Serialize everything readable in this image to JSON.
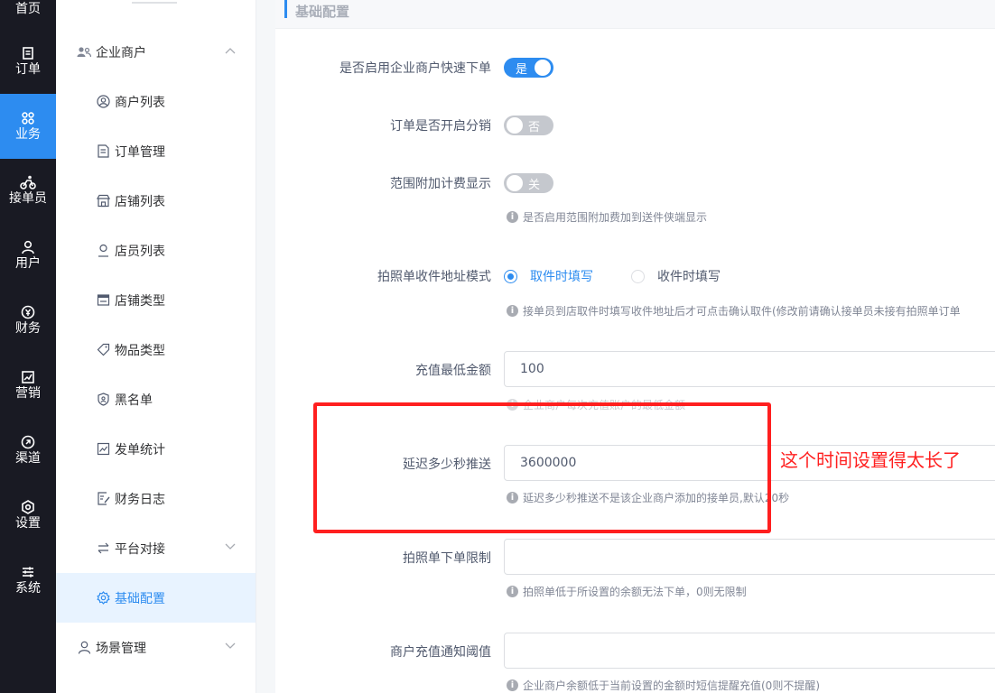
{
  "rail": {
    "items": [
      {
        "label": "首页",
        "icon": "home-icon"
      },
      {
        "label": "订单",
        "icon": "order-icon"
      },
      {
        "label": "业务",
        "icon": "business-icon"
      },
      {
        "label": "接单员",
        "icon": "courier-icon"
      },
      {
        "label": "用户",
        "icon": "user-icon"
      },
      {
        "label": "财务",
        "icon": "finance-icon"
      },
      {
        "label": "营销",
        "icon": "marketing-icon"
      },
      {
        "label": "渠道",
        "icon": "channel-icon"
      },
      {
        "label": "设置",
        "icon": "settings-icon"
      },
      {
        "label": "系统",
        "icon": "system-icon"
      }
    ],
    "active_index": 2
  },
  "submenu": {
    "group_label": "企业商户",
    "items": [
      {
        "label": "商户列表",
        "icon": "merchant-icon"
      },
      {
        "label": "订单管理",
        "icon": "doc-icon"
      },
      {
        "label": "店铺列表",
        "icon": "store-icon"
      },
      {
        "label": "店员列表",
        "icon": "staff-icon"
      },
      {
        "label": "店铺类型",
        "icon": "store-type-icon"
      },
      {
        "label": "物品类型",
        "icon": "tag-icon"
      },
      {
        "label": "黑名单",
        "icon": "shield-icon"
      },
      {
        "label": "发单统计",
        "icon": "chart-icon"
      },
      {
        "label": "财务日志",
        "icon": "log-icon"
      },
      {
        "label": "平台对接",
        "icon": "swap-icon"
      },
      {
        "label": "基础配置",
        "icon": "gear-icon"
      }
    ],
    "active_label": "基础配置",
    "scene_label": "场景管理"
  },
  "panel": {
    "title": "基础配置"
  },
  "form": {
    "quick_order": {
      "label": "是否启用企业商户快速下单",
      "value": "是",
      "enabled": true
    },
    "distribution": {
      "label": "订单是否开启分销",
      "value": "否",
      "enabled": false
    },
    "range_fee": {
      "label": "范围附加计费显示",
      "value": "关",
      "enabled": false,
      "help": "是否启用范围附加费加到送件侠端显示"
    },
    "photo_address": {
      "label": "拍照单收件地址模式",
      "options": [
        "取件时填写",
        "收件时填写"
      ],
      "selected": "取件时填写",
      "help": "接单员到店取件时填写收件地址后才可点击确认取件(修改前请确认接单员未接有拍照单订单"
    },
    "min_recharge": {
      "label": "充值最低金额",
      "value": "100",
      "help": "企业商户每次充值账户的最低金额"
    },
    "delay_push": {
      "label": "延迟多少秒推送",
      "value": "3600000",
      "help": "延迟多少秒推送不是该企业商户添加的接单员,默认20秒"
    },
    "photo_limit": {
      "label": "拍照单下单限制",
      "value": "",
      "help": "拍照单低于所设置的余额无法下单，0则无限制"
    },
    "recharge_notice": {
      "label": "商户充值通知阈值",
      "value": "",
      "help": "企业商户余额低于当前设置的金额时短信提醒充值(0则不提醒)"
    }
  },
  "annotation": {
    "text": "这个时间设置得太长了",
    "color": "#ff1f1f"
  },
  "colors": {
    "accent": "#2d8cf0",
    "rail_bg": "#191a23",
    "highlight": "#ff1f1f"
  }
}
